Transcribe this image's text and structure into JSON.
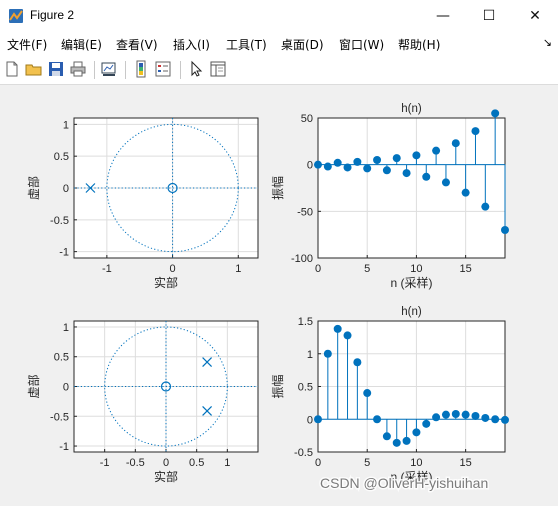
{
  "window": {
    "title": "Figure 2",
    "minimize_glyph": "—",
    "maximize_glyph": "☐",
    "close_glyph": "✕"
  },
  "menu": [
    {
      "label": "文件(F)"
    },
    {
      "label": "编辑(E)"
    },
    {
      "label": "查看(V)"
    },
    {
      "label": "插入(I)"
    },
    {
      "label": "工具(T)"
    },
    {
      "label": "桌面(D)"
    },
    {
      "label": "窗口(W)"
    },
    {
      "label": "帮助(H)"
    }
  ],
  "menu_overflow": "↘",
  "toolbar_icons": [
    "new-figure-icon",
    "open-file-icon",
    "save-icon",
    "print-icon",
    "link-plot-icon",
    "insert-colorbar-icon",
    "insert-legend-icon",
    "edit-plot-icon",
    "property-inspector-icon"
  ],
  "colors": {
    "marker": "#0072bd",
    "grid": "#dddddd",
    "axes_bg": "#ffffff"
  },
  "watermark": "CSDN @OliverH-yishuihan",
  "chart_data": [
    {
      "type": "scatter",
      "name": "zero-pole plot 1",
      "xlabel": "实部",
      "ylabel": "虚部",
      "xlim": [
        -1.5,
        1.3
      ],
      "ylim": [
        -1.1,
        1.1
      ],
      "xticks": [
        -1,
        0,
        1
      ],
      "xtick_labels": [
        "-1",
        "0",
        "1"
      ],
      "yticks": [
        -1,
        -0.5,
        0,
        0.5,
        1
      ],
      "ytick_labels": [
        "-1",
        "-0.5",
        "0",
        "0.5",
        "1"
      ],
      "zeros": [
        [
          0,
          0
        ]
      ],
      "poles": [
        [
          -1.25,
          0
        ]
      ],
      "unit_circle": true,
      "grid": true
    },
    {
      "type": "stem",
      "title": "h(n)",
      "xlabel": "n (采样)",
      "ylabel": "振幅",
      "xlim": [
        0,
        19
      ],
      "ylim": [
        -100,
        50
      ],
      "xticks": [
        0,
        5,
        10,
        15
      ],
      "xtick_labels": [
        "0",
        "5",
        "10",
        "15"
      ],
      "yticks": [
        -100,
        -50,
        0,
        50
      ],
      "ytick_labels": [
        "-100",
        "-50",
        "0",
        "50"
      ],
      "x": [
        0,
        1,
        2,
        3,
        4,
        5,
        6,
        7,
        8,
        9,
        10,
        11,
        12,
        13,
        14,
        15,
        16,
        17,
        18,
        19
      ],
      "values": [
        0,
        -2,
        2,
        -3,
        3,
        -4,
        5,
        -6,
        7,
        -9,
        10,
        -13,
        15,
        -19,
        23,
        -30,
        36,
        -45,
        55,
        -70
      ],
      "grid": true
    },
    {
      "type": "scatter",
      "name": "zero-pole plot 2",
      "xlabel": "实部",
      "ylabel": "虚部",
      "xlim": [
        -1.5,
        1.5
      ],
      "ylim": [
        -1.1,
        1.1
      ],
      "xticks": [
        -1,
        -0.5,
        0,
        0.5,
        1
      ],
      "xtick_labels": [
        "-1",
        "-0.5",
        "0",
        "0.5",
        "1"
      ],
      "yticks": [
        -1,
        -0.5,
        0,
        0.5,
        1
      ],
      "ytick_labels": [
        "-1",
        "-0.5",
        "0",
        "0.5",
        "1"
      ],
      "zeros": [
        [
          0,
          0
        ]
      ],
      "poles": [
        [
          0.67,
          0.41
        ],
        [
          0.67,
          -0.41
        ]
      ],
      "unit_circle": true,
      "grid": true
    },
    {
      "type": "stem",
      "title": "h(n)",
      "xlabel": "n (采样)",
      "ylabel": "振幅",
      "xlim": [
        0,
        19
      ],
      "ylim": [
        -0.5,
        1.5
      ],
      "xticks": [
        0,
        5,
        10,
        15
      ],
      "xtick_labels": [
        "0",
        "5",
        "10",
        "15"
      ],
      "yticks": [
        -0.5,
        0,
        0.5,
        1,
        1.5
      ],
      "ytick_labels": [
        "-0.5",
        "0",
        "0.5",
        "1",
        "1.5"
      ],
      "x": [
        0,
        1,
        2,
        3,
        4,
        5,
        6,
        7,
        8,
        9,
        10,
        11,
        12,
        13,
        14,
        15,
        16,
        17,
        18,
        19
      ],
      "values": [
        0,
        1.0,
        1.38,
        1.28,
        0.87,
        0.4,
        0.0,
        -0.26,
        -0.36,
        -0.33,
        -0.2,
        -0.07,
        0.03,
        0.07,
        0.08,
        0.07,
        0.05,
        0.02,
        0.0,
        -0.01
      ],
      "grid": true
    }
  ]
}
